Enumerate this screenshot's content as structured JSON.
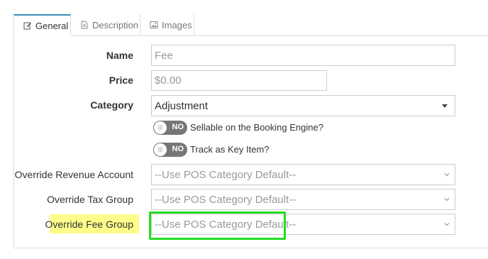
{
  "tabs": [
    {
      "label": "General",
      "icon": "edit-icon",
      "active": true
    },
    {
      "label": "Description",
      "icon": "file-text-icon",
      "active": false
    },
    {
      "label": "Images",
      "icon": "image-icon",
      "active": false
    }
  ],
  "form": {
    "name": {
      "label": "Name",
      "value": "Fee"
    },
    "price": {
      "label": "Price",
      "value": "$0.00"
    },
    "category": {
      "label": "Category",
      "value": "Adjustment"
    },
    "sellable_toggle": {
      "state": "NO",
      "label": "Sellable on the Booking Engine?"
    },
    "key_item_toggle": {
      "state": "NO",
      "label": "Track as Key Item?"
    },
    "override_revenue": {
      "label": "Override Revenue Account",
      "value": "--Use POS Category Default--"
    },
    "override_tax": {
      "label": "Override Tax Group",
      "value": "--Use POS Category Default--"
    },
    "override_fee": {
      "label": "Override Fee Group",
      "value": "--Use POS Category Default--"
    }
  },
  "colors": {
    "active_tab_border": "#3c8dbc",
    "toggle_off": "#777777",
    "highlight_yellow": "#fdfd8a",
    "annotation_green": "#22dd22"
  }
}
